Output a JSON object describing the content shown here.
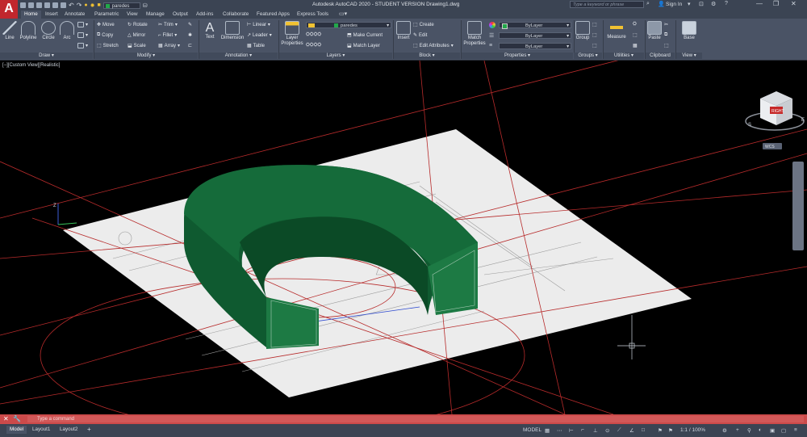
{
  "app": {
    "logo_letter": "A",
    "title": "Autodesk AutoCAD 2020 - STUDENT VERSION    Drawing1.dwg"
  },
  "qat": {
    "layer_value": "paredes"
  },
  "topbar": {
    "search_placeholder": "Type a keyword or phrase",
    "sign_in": "Sign In"
  },
  "tabs": [
    "Home",
    "Insert",
    "Annotate",
    "Parametric",
    "View",
    "Manage",
    "Output",
    "Add-ins",
    "Collaborate",
    "Featured Apps",
    "Express Tools"
  ],
  "ribbon": {
    "draw": {
      "title": "Draw",
      "line": "Line",
      "polyline": "Polyline",
      "circle": "Circle",
      "arc": "Arc"
    },
    "modify": {
      "title": "Modify",
      "move": "Move",
      "rotate": "Rotate",
      "trim": "Trim",
      "copy": "Copy",
      "mirror": "Mirror",
      "fillet": "Fillet",
      "stretch": "Stretch",
      "scale": "Scale",
      "array": "Array"
    },
    "annotation": {
      "title": "Annotation",
      "text": "Text",
      "dimension": "Dimension",
      "linear": "Linear",
      "leader": "Leader",
      "table": "Table"
    },
    "layers": {
      "title": "Layers",
      "layer_properties": "Layer Properties",
      "current_layer": "paredes",
      "make_current": "Make Current",
      "match_layer": "Match Layer"
    },
    "block": {
      "title": "Block",
      "insert": "Insert",
      "create": "Create",
      "edit": "Edit",
      "edit_attributes": "Edit Attributes"
    },
    "properties": {
      "title": "Properties",
      "match_properties": "Match Properties",
      "color": "ByLayer",
      "linetype": "ByLayer",
      "lineweight": "ByLayer"
    },
    "groups": {
      "title": "Groups",
      "group": "Group"
    },
    "utilities": {
      "title": "Utilities",
      "measure": "Measure"
    },
    "clipboard": {
      "title": "Clipboard",
      "paste": "Paste"
    },
    "view": {
      "title": "View",
      "base": "Base"
    }
  },
  "viewport": {
    "label": "[−][Custom View][Realistic]",
    "viewcube_face": "RIGHT",
    "wcs": "WCS",
    "compass_s": "S",
    "compass_e": "E",
    "axis_z": "Z"
  },
  "command": {
    "placeholder": "Type a command"
  },
  "layout_tabs": [
    "Model",
    "Layout1",
    "Layout2"
  ],
  "status": {
    "model": "MODEL",
    "scale": "1:1 / 100%"
  },
  "colors": {
    "wall_green": "#0f5a30",
    "layer_green": "#22a84a",
    "ribbon_bg": "#4a5365",
    "command_red": "#cc4a4a"
  }
}
